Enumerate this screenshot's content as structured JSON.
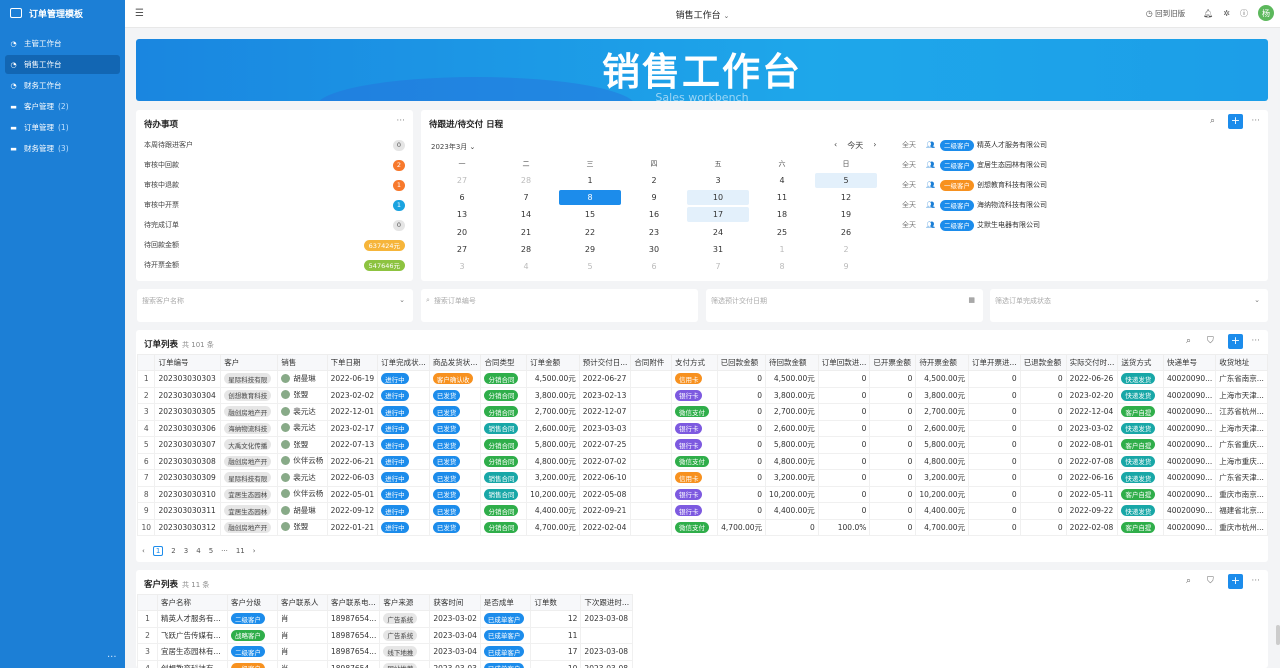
{
  "app": {
    "title": "订单管理模板"
  },
  "sidebar": {
    "items": [
      {
        "label": "主管工作台",
        "count": "",
        "icon": "dashboard-icon",
        "active": false
      },
      {
        "label": "销售工作台",
        "count": "",
        "icon": "dashboard-icon",
        "active": true
      },
      {
        "label": "财务工作台",
        "count": "",
        "icon": "dashboard-icon",
        "active": false
      },
      {
        "label": "客户管理",
        "count": "(2)",
        "icon": "folder-icon",
        "active": false
      },
      {
        "label": "订单管理",
        "count": "(1)",
        "icon": "folder-icon",
        "active": false
      },
      {
        "label": "财务管理",
        "count": "(3)",
        "icon": "folder-icon",
        "active": false
      }
    ],
    "more": "..."
  },
  "topbar": {
    "title": "销售工作台",
    "back_label": "回到旧版"
  },
  "user": {
    "avatar_letter": "杨"
  },
  "banner": {
    "title": "销售工作台",
    "subtitle": "Sales workbench"
  },
  "todo": {
    "title": "待办事项",
    "rows": [
      {
        "label": "本周待跟进客户",
        "value": "0",
        "style": "p-gray"
      },
      {
        "label": "审核中回款",
        "value": "2",
        "style": "p-orange"
      },
      {
        "label": "审核中退款",
        "value": "1",
        "style": "p-orange"
      },
      {
        "label": "审核中开票",
        "value": "1",
        "style": "p-blue"
      },
      {
        "label": "待完成订单",
        "value": "0",
        "style": "p-gray"
      },
      {
        "label": "待回款金额",
        "value": "637424元",
        "style": "p-yellow"
      },
      {
        "label": "待开票金额",
        "value": "547646元",
        "style": "p-green"
      }
    ]
  },
  "calendar": {
    "title": "待跟进/待交付 日程",
    "month": "2023年3月",
    "today": "今天",
    "dow": [
      "一",
      "二",
      "三",
      "四",
      "五",
      "六",
      "日"
    ],
    "weeks": [
      [
        [
          "27",
          1
        ],
        [
          "28",
          1
        ],
        [
          "1",
          0
        ],
        [
          "2",
          0
        ],
        [
          "3",
          0
        ],
        [
          "4",
          0
        ],
        [
          "5",
          0
        ]
      ],
      [
        [
          "6",
          0
        ],
        [
          "7",
          0
        ],
        [
          "8",
          0
        ],
        [
          "9",
          0
        ],
        [
          "10",
          0
        ],
        [
          "11",
          0
        ],
        [
          "12",
          0
        ]
      ],
      [
        [
          "13",
          0
        ],
        [
          "14",
          0
        ],
        [
          "15",
          0
        ],
        [
          "16",
          0
        ],
        [
          "17",
          0
        ],
        [
          "18",
          0
        ],
        [
          "19",
          0
        ]
      ],
      [
        [
          "20",
          0
        ],
        [
          "21",
          0
        ],
        [
          "22",
          0
        ],
        [
          "23",
          0
        ],
        [
          "24",
          0
        ],
        [
          "25",
          0
        ],
        [
          "26",
          0
        ]
      ],
      [
        [
          "27",
          0
        ],
        [
          "28",
          0
        ],
        [
          "29",
          0
        ],
        [
          "30",
          0
        ],
        [
          "31",
          0
        ],
        [
          "1",
          1
        ],
        [
          "2",
          1
        ]
      ],
      [
        [
          "3",
          1
        ],
        [
          "4",
          1
        ],
        [
          "5",
          1
        ],
        [
          "6",
          1
        ],
        [
          "7",
          1
        ],
        [
          "8",
          1
        ],
        [
          "9",
          1
        ]
      ]
    ],
    "events": [
      {
        "allday": "全天",
        "tag": "二级客户",
        "tag_style": "t-blue",
        "name": "精英人才服务有限公司"
      },
      {
        "allday": "全天",
        "tag": "二级客户",
        "tag_style": "t-blue",
        "name": "宜居生态园林有限公司"
      },
      {
        "allday": "全天",
        "tag": "一级客户",
        "tag_style": "t-orange",
        "name": "创想教育科技有限公司"
      },
      {
        "allday": "全天",
        "tag": "二级客户",
        "tag_style": "t-blue",
        "name": "海纳物流科技有限公司"
      },
      {
        "allday": "全天",
        "tag": "二级客户",
        "tag_style": "t-blue",
        "name": "艾默生电器有限公司"
      }
    ]
  },
  "filters": [
    {
      "placeholder": "搜索客户名称",
      "icon": "chevron-down-icon"
    },
    {
      "placeholder": "搜索订单编号",
      "icon": "search-icon"
    },
    {
      "placeholder": "筛选预计交付日期",
      "icon": "calendar-icon"
    },
    {
      "placeholder": "筛选订单完成状态",
      "icon": "chevron-down-icon"
    }
  ],
  "orders": {
    "title": "订单列表",
    "count": "共 101 条",
    "columns": [
      "",
      "订单编号",
      "客户",
      "销售",
      "下单日期",
      "订单完成状...",
      "商品发货状...",
      "合同类型",
      "订单金额",
      "预计交付日...",
      "合同附件",
      "支付方式",
      "已回款金额",
      "待回款金额",
      "订单回款进...",
      "已开票金额",
      "待开票金额",
      "订单开票进...",
      "已退款金额",
      "实际交付时...",
      "送货方式",
      "快递单号",
      "收货地址"
    ],
    "rows": [
      [
        "1",
        "202303030303",
        "星际科技有限",
        "胡曼琳",
        "2022-06-19",
        "进行中",
        "客户确认收",
        "分销合同",
        "4,500.00元",
        "2022-06-27",
        "",
        "信用卡",
        "0",
        "4,500.00元",
        "0",
        "0",
        "4,500.00元",
        "0",
        "0",
        "2022-06-26",
        "快递发货",
        "40020090...",
        "广东省南京..."
      ],
      [
        "2",
        "202303030304",
        "创想教育科技",
        "张盟",
        "2023-02-02",
        "进行中",
        "已发货",
        "分销合同",
        "3,800.00元",
        "2023-02-13",
        "",
        "银行卡",
        "0",
        "3,800.00元",
        "0",
        "0",
        "3,800.00元",
        "0",
        "0",
        "2023-02-20",
        "快递发货",
        "40020090...",
        "上海市天津..."
      ],
      [
        "3",
        "202303030305",
        "融创房地产开",
        "裴元达",
        "2022-12-01",
        "进行中",
        "已发货",
        "分销合同",
        "2,700.00元",
        "2022-12-07",
        "",
        "微信支付",
        "0",
        "2,700.00元",
        "0",
        "0",
        "2,700.00元",
        "0",
        "0",
        "2022-12-04",
        "客户自提",
        "40020090...",
        "江苏省杭州..."
      ],
      [
        "4",
        "202303030306",
        "海纳物流科技",
        "裴元达",
        "2023-02-17",
        "进行中",
        "已发货",
        "销售合同",
        "2,600.00元",
        "2023-03-03",
        "",
        "银行卡",
        "0",
        "2,600.00元",
        "0",
        "0",
        "2,600.00元",
        "0",
        "0",
        "2023-03-02",
        "快递发货",
        "40020090...",
        "上海市天津..."
      ],
      [
        "5",
        "202303030307",
        "大禹文化传播",
        "张盟",
        "2022-07-13",
        "进行中",
        "已发货",
        "分销合同",
        "5,800.00元",
        "2022-07-25",
        "",
        "银行卡",
        "0",
        "5,800.00元",
        "0",
        "0",
        "5,800.00元",
        "0",
        "0",
        "2022-08-01",
        "客户自提",
        "40020090...",
        "广东省重庆..."
      ],
      [
        "6",
        "202303030308",
        "融创房地产开",
        "伙伴云杨",
        "2022-06-21",
        "进行中",
        "已发货",
        "分销合同",
        "4,800.00元",
        "2022-07-02",
        "",
        "微信支付",
        "0",
        "4,800.00元",
        "0",
        "0",
        "4,800.00元",
        "0",
        "0",
        "2022-07-08",
        "快递发货",
        "40020090...",
        "上海市重庆..."
      ],
      [
        "7",
        "202303030309",
        "星际科技有限",
        "裴元达",
        "2022-06-03",
        "进行中",
        "已发货",
        "销售合同",
        "3,200.00元",
        "2022-06-10",
        "",
        "信用卡",
        "0",
        "3,200.00元",
        "0",
        "0",
        "3,200.00元",
        "0",
        "0",
        "2022-06-16",
        "快递发货",
        "40020090...",
        "广东省天津..."
      ],
      [
        "8",
        "202303030310",
        "宜居生态园林",
        "伙伴云杨",
        "2022-05-01",
        "进行中",
        "已发货",
        "销售合同",
        "10,200.00元",
        "2022-05-08",
        "",
        "银行卡",
        "0",
        "10,200.00元",
        "0",
        "0",
        "10,200.00元",
        "0",
        "0",
        "2022-05-11",
        "客户自提",
        "40020090...",
        "重庆市南京..."
      ],
      [
        "9",
        "202303030311",
        "宜居生态园林",
        "胡曼琳",
        "2022-09-12",
        "进行中",
        "已发货",
        "分销合同",
        "4,400.00元",
        "2022-09-21",
        "",
        "银行卡",
        "0",
        "4,400.00元",
        "0",
        "0",
        "4,400.00元",
        "0",
        "0",
        "2022-09-22",
        "快递发货",
        "40020090...",
        "福建省北京..."
      ],
      [
        "10",
        "202303030312",
        "融创房地产开",
        "张盟",
        "2022-01-21",
        "进行中",
        "已发货",
        "分销合同",
        "4,700.00元",
        "2022-02-04",
        "",
        "微信支付",
        "4,700.00元",
        "0",
        "100.0%",
        "0",
        "4,700.00元",
        "0",
        "0",
        "2022-02-08",
        "客户自提",
        "40020090...",
        "重庆市杭州..."
      ]
    ],
    "pager": {
      "prev": "‹",
      "pages": [
        "1",
        "2",
        "3",
        "4",
        "5"
      ],
      "ellipsis": "···",
      "last": "11",
      "next": "›"
    }
  },
  "customers": {
    "title": "客户列表",
    "count": "共 11 条",
    "columns": [
      "",
      "客户名称",
      "客户分级",
      "客户联系人",
      "客户联系电...",
      "客户来源",
      "获客时间",
      "是否成单",
      "订单数",
      "下次跟进时..."
    ],
    "rows": [
      [
        "1",
        "精英人才服务有...",
        "二级客户",
        "肖",
        "18987654...",
        "广告系统",
        "2023-03-02",
        "已成单客户",
        "12",
        "2023-03-08"
      ],
      [
        "2",
        "飞跃广告传媒有...",
        "战略客户",
        "肖",
        "18987654...",
        "广告系统",
        "2023-03-04",
        "已成单客户",
        "11",
        ""
      ],
      [
        "3",
        "宜居生态园林有...",
        "二级客户",
        "肖",
        "18987654...",
        "线下地推",
        "2023-03-04",
        "已成单客户",
        "17",
        "2023-03-08"
      ],
      [
        "4",
        "创想教育科技有...",
        "一级客户",
        "肖",
        "18987654...",
        "网站推荐",
        "2023-03-03",
        "已成单客户",
        "10",
        "2023-03-08"
      ]
    ]
  },
  "colors": {
    "primary": "#1c8ceb",
    "sidebar": "#1c7fd6",
    "orange": "#f7792c",
    "green": "#2fae4a"
  }
}
